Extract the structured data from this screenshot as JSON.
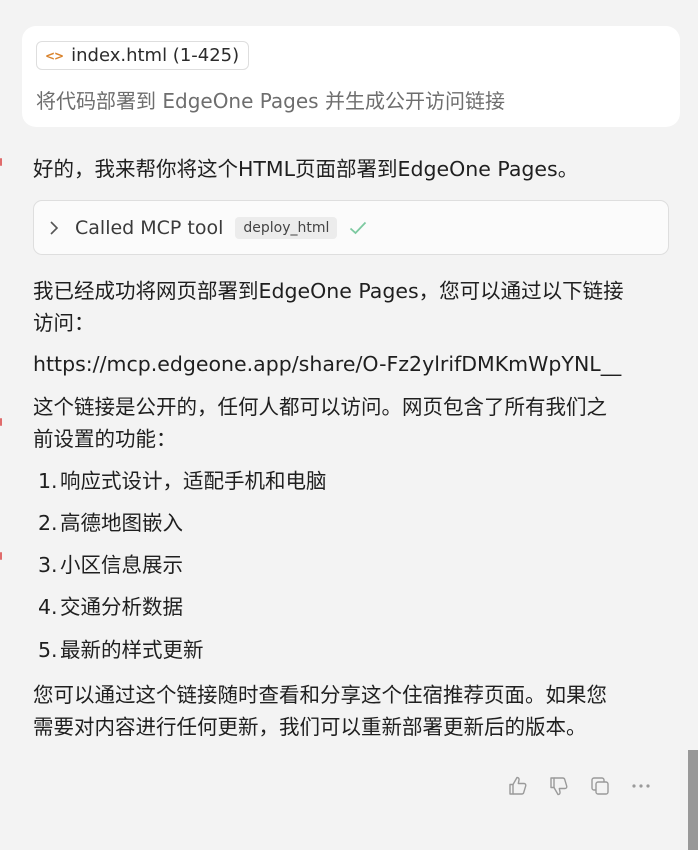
{
  "user_message": {
    "file_chip": "index.html (1-425)",
    "text": "将代码部署到 EdgeOne Pages 并生成公开访问链接"
  },
  "reply": {
    "intro": "好的，我来帮你将这个HTML页面部署到EdgeOne Pages。",
    "tool_call": {
      "title": "Called MCP tool",
      "tool_name": "deploy_html",
      "status": "success"
    },
    "success_line1": "我已经成功将网页部署到EdgeOne Pages，您可以通过以下链接",
    "success_line2": "访问：",
    "url": "https://mcp.edgeone.app/share/O-Fz2ylrifDMKmWpYNL__",
    "public_line1": "这个链接是公开的，任何人都可以访问。网页包含了所有我们之",
    "public_line2": "前设置的功能：",
    "features": [
      {
        "num": "1.",
        "text": "响应式设计，适配手机和电脑"
      },
      {
        "num": "2.",
        "text": "高德地图嵌入"
      },
      {
        "num": "3.",
        "text": "小区信息展示"
      },
      {
        "num": "4.",
        "text": "交通分析数据"
      },
      {
        "num": "5.",
        "text": "最新的样式更新"
      }
    ],
    "closing_line1": "您可以通过这个链接随时查看和分享这个住宿推荐页面。如果您",
    "closing_line2": "需要对内容进行任何更新，我们可以重新部署更新后的版本。"
  },
  "actions": [
    "thumbs-up-icon",
    "thumbs-down-icon",
    "copy-icon",
    "more-icon"
  ],
  "colors": {
    "background": "#f3f3f3",
    "card": "#ffffff",
    "check": "#7cc9a0",
    "code_icon": "#d9822b"
  }
}
